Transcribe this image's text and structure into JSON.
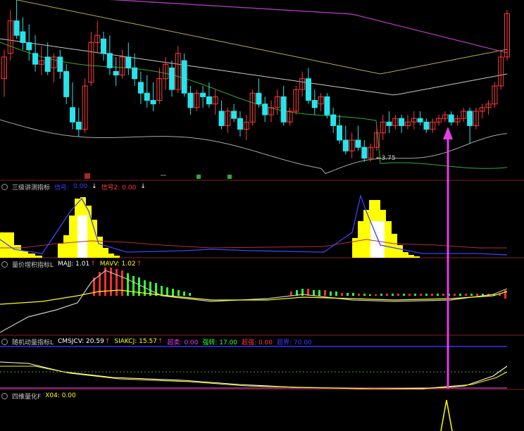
{
  "colors": {
    "up": "#ff3b3b",
    "down": "#29e3ea",
    "ma_green": "#2fae2f",
    "ma_yellow": "#b5a64a",
    "ma_purple": "#a53ab3",
    "ma_white": "#c8c8c8",
    "band_low": "#a9a9a9",
    "sep": "#8a1c1c",
    "magenta": "#e83ce8",
    "yellow": "#ffff00",
    "blue": "#3232ff",
    "green_bar": "#33ff33",
    "red_bar": "#ff2d2d"
  },
  "main_panel": {
    "low_label": "3.75",
    "marker_icons": [
      "green-flag-icon",
      "green-flag-icon",
      "small-dash-icon"
    ]
  },
  "panels": [
    {
      "id": "p1",
      "name": "三级讲测指标",
      "items": [
        {
          "text": "信号:",
          "color": "#3c3cff"
        },
        {
          "text": "0.00",
          "color": "#3c3cff"
        },
        {
          "text": "↓",
          "color": "#ffffff"
        },
        {
          "text": "信号2: 0.00",
          "color": "#ff3b3b"
        },
        {
          "text": "↓",
          "color": "#ffffff"
        }
      ]
    },
    {
      "id": "p2",
      "name": "量价增积指标L",
      "items": [
        {
          "text": "MAJJ: 1.01",
          "color": "#ffffff"
        },
        {
          "text": "↑",
          "color": "#ff3b3b"
        },
        {
          "text": "MAVV: 1.02",
          "color": "#ffff00"
        },
        {
          "text": "↑",
          "color": "#ff3b3b"
        }
      ]
    },
    {
      "id": "p3",
      "name": "随机动量指标L",
      "items": [
        {
          "text": "CMSJCV: 20.59",
          "color": "#ffffff"
        },
        {
          "text": "↑",
          "color": "#ff3b3b"
        },
        {
          "text": "SIAKCJ: 15.57",
          "color": "#ffff00"
        },
        {
          "text": "↑",
          "color": "#ff3b3b"
        },
        {
          "text": "超卖: 0.00",
          "color": "#e83ce8"
        },
        {
          "text": "强转: 17.00",
          "color": "#33ff33"
        },
        {
          "text": "超强: 0.00",
          "color": "#ff3b3b"
        },
        {
          "text": "超界: 70.00",
          "color": "#3c3cff"
        }
      ]
    },
    {
      "id": "p4",
      "name": "四维量化F",
      "items": [
        {
          "text": "X04: 0.00",
          "color": "#ffff00"
        }
      ]
    }
  ],
  "chart_data": {
    "type": "candlestick",
    "price_range": [
      3.7,
      6.0
    ],
    "candles": [
      [
        4.95,
        5.35,
        4.7,
        5.25
      ],
      [
        5.3,
        5.9,
        5.2,
        5.75
      ],
      [
        5.75,
        6.05,
        5.5,
        5.55
      ],
      [
        5.6,
        5.8,
        5.35,
        5.45
      ],
      [
        5.45,
        5.7,
        5.2,
        5.35
      ],
      [
        5.3,
        5.55,
        5.05,
        5.15
      ],
      [
        5.15,
        5.4,
        5.0,
        5.2
      ],
      [
        5.25,
        5.45,
        5.0,
        5.05
      ],
      [
        5.1,
        5.3,
        4.9,
        5.25
      ],
      [
        5.25,
        5.35,
        4.95,
        5.05
      ],
      [
        5.05,
        5.15,
        4.6,
        4.7
      ],
      [
        4.55,
        4.9,
        4.25,
        4.35
      ],
      [
        4.35,
        4.55,
        4.15,
        4.25
      ],
      [
        4.25,
        4.95,
        4.2,
        4.85
      ],
      [
        4.9,
        5.6,
        4.85,
        5.45
      ],
      [
        5.45,
        5.75,
        5.3,
        5.55
      ],
      [
        5.5,
        5.6,
        5.2,
        5.3
      ],
      [
        5.3,
        5.55,
        5.0,
        5.1
      ],
      [
        5.05,
        5.25,
        4.85,
        5.0
      ],
      [
        5.0,
        5.35,
        4.95,
        5.25
      ],
      [
        5.25,
        5.45,
        5.0,
        5.1
      ],
      [
        5.1,
        5.3,
        4.85,
        4.95
      ],
      [
        4.9,
        5.05,
        4.6,
        4.75
      ],
      [
        4.75,
        5.0,
        4.55,
        4.65
      ],
      [
        4.65,
        4.9,
        4.5,
        4.6
      ],
      [
        4.65,
        5.1,
        4.6,
        4.95
      ],
      [
        4.95,
        5.25,
        4.8,
        5.15
      ],
      [
        5.1,
        5.2,
        4.7,
        4.8
      ],
      [
        4.8,
        5.4,
        4.75,
        5.3
      ],
      [
        5.2,
        5.3,
        4.7,
        4.75
      ],
      [
        4.75,
        4.85,
        4.45,
        4.55
      ],
      [
        4.55,
        4.8,
        4.5,
        4.75
      ],
      [
        4.75,
        4.85,
        4.55,
        4.7
      ],
      [
        4.7,
        4.9,
        4.55,
        4.6
      ],
      [
        4.6,
        4.8,
        4.45,
        4.7
      ],
      [
        4.5,
        4.65,
        4.25,
        4.3
      ],
      [
        4.3,
        4.55,
        4.2,
        4.5
      ],
      [
        4.5,
        4.6,
        4.35,
        4.4
      ],
      [
        4.4,
        4.5,
        4.15,
        4.25
      ],
      [
        4.25,
        4.45,
        4.1,
        4.35
      ],
      [
        4.35,
        4.8,
        4.3,
        4.75
      ],
      [
        4.75,
        4.95,
        4.55,
        4.6
      ],
      [
        4.6,
        4.7,
        4.35,
        4.45
      ],
      [
        4.45,
        4.65,
        4.35,
        4.55
      ],
      [
        4.55,
        4.8,
        4.45,
        4.7
      ],
      [
        4.7,
        4.85,
        4.3,
        4.35
      ],
      [
        4.35,
        4.55,
        4.3,
        4.5
      ],
      [
        4.5,
        4.85,
        4.45,
        4.8
      ],
      [
        4.8,
        5.05,
        4.7,
        4.95
      ],
      [
        4.95,
        5.1,
        4.6,
        4.65
      ],
      [
        4.65,
        4.8,
        4.45,
        4.55
      ],
      [
        4.6,
        4.75,
        4.5,
        4.7
      ],
      [
        4.7,
        4.75,
        4.4,
        4.45
      ],
      [
        4.45,
        4.55,
        4.2,
        4.3
      ],
      [
        4.3,
        4.45,
        4.05,
        4.1
      ],
      [
        4.1,
        4.3,
        3.9,
        3.95
      ],
      [
        3.95,
        4.2,
        3.85,
        4.1
      ],
      [
        4.1,
        4.3,
        3.95,
        4.0
      ],
      [
        4.0,
        4.1,
        3.8,
        3.85
      ],
      [
        3.85,
        4.05,
        3.8,
        4.0
      ],
      [
        4.0,
        4.3,
        3.95,
        4.2
      ],
      [
        4.2,
        4.45,
        4.1,
        4.35
      ],
      [
        4.35,
        4.5,
        4.2,
        4.3
      ],
      [
        4.3,
        4.45,
        4.25,
        4.4
      ],
      [
        4.4,
        4.45,
        4.2,
        4.3
      ],
      [
        4.3,
        4.45,
        4.25,
        4.35
      ],
      [
        4.35,
        4.5,
        4.25,
        4.4
      ],
      [
        4.4,
        4.5,
        4.3,
        4.35
      ],
      [
        4.35,
        4.4,
        4.2,
        4.25
      ],
      [
        4.25,
        4.4,
        4.2,
        4.35
      ],
      [
        4.35,
        4.45,
        4.3,
        4.4
      ],
      [
        4.4,
        4.5,
        4.35,
        4.45
      ],
      [
        4.45,
        4.5,
        4.3,
        4.35
      ],
      [
        4.35,
        4.45,
        4.3,
        4.4
      ],
      [
        4.4,
        4.55,
        4.35,
        4.5
      ],
      [
        4.5,
        4.55,
        4.05,
        4.3
      ],
      [
        4.3,
        4.55,
        4.25,
        4.5
      ],
      [
        4.5,
        4.6,
        4.4,
        4.55
      ],
      [
        4.55,
        4.65,
        4.45,
        4.6
      ],
      [
        4.6,
        4.9,
        4.55,
        4.85
      ],
      [
        4.85,
        5.35,
        4.8,
        5.25
      ],
      [
        5.25,
        5.9,
        5.2,
        5.85
      ]
    ]
  }
}
